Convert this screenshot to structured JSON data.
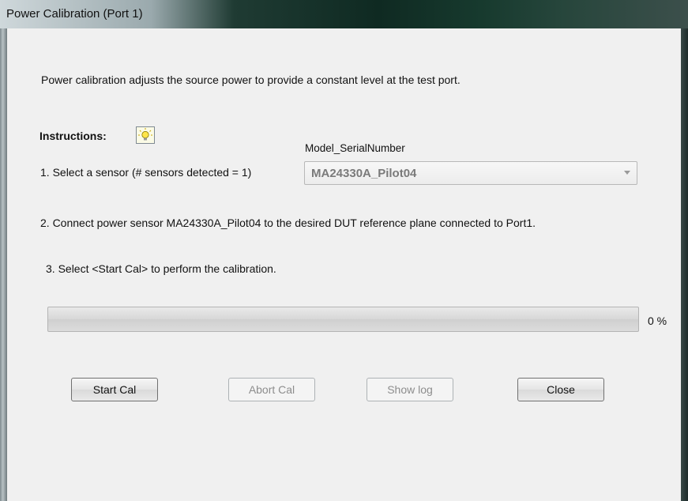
{
  "window": {
    "title": "Power Calibration (Port 1)"
  },
  "intro": "Power calibration adjusts the source power to provide a constant level at the test port.",
  "instructions": {
    "label": "Instructions:",
    "icon": "lightbulb-icon"
  },
  "sensor": {
    "step1": "1. Select a sensor  (# sensors detected = 1)",
    "column_label": "Model_SerialNumber",
    "selected": "MA24330A_Pilot04"
  },
  "step2": "2. Connect power sensor MA24330A_Pilot04 to the desired DUT reference plane connected to Port1.",
  "step3": "3.  Select <Start Cal> to perform the calibration.",
  "progress": {
    "value": 0,
    "label": "0 %"
  },
  "buttons": {
    "start": "Start Cal",
    "abort": "Abort Cal",
    "log": "Show log",
    "close": "Close"
  },
  "colors": {
    "progress_fill": "#37b24a",
    "disabled_text": "#8d8d8d"
  }
}
